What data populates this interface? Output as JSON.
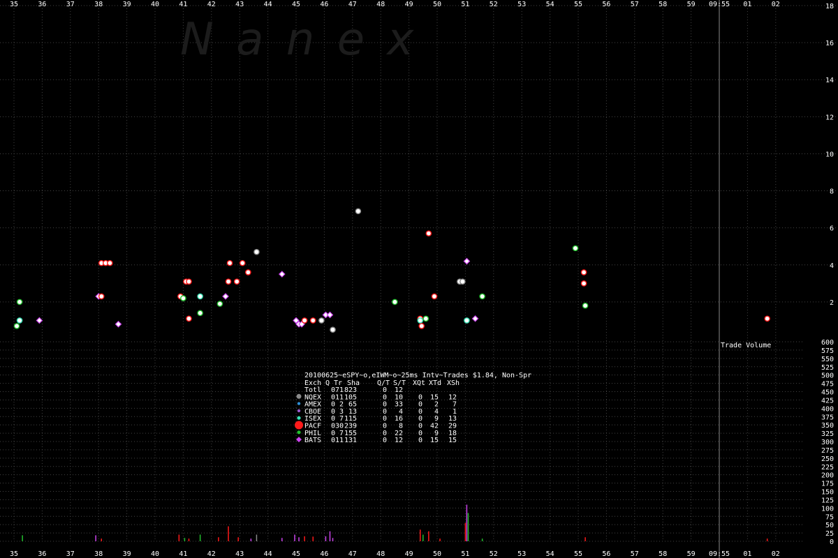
{
  "watermark": "N  a  n  e  x",
  "chart_data": {
    "type": "scatter",
    "x_ticks": [
      "35",
      "36",
      "37",
      "38",
      "39",
      "40",
      "41",
      "42",
      "43",
      "44",
      "45",
      "46",
      "47",
      "48",
      "49",
      "50",
      "51",
      "52",
      "53",
      "54",
      "55",
      "56",
      "57",
      "58",
      "59",
      "09:55",
      "01",
      "02"
    ],
    "x_ticks_bottom": [
      "35",
      "36",
      "37",
      "38",
      "39",
      "40",
      "41",
      "42",
      "43",
      "44",
      "45",
      "46",
      "47",
      "48",
      "49",
      "50",
      "51",
      "52",
      "53",
      "54",
      "55",
      "56",
      "57",
      "58",
      "59",
      "09:55",
      "01",
      "02"
    ],
    "grid": true,
    "price_panel": {
      "ylim": [
        0,
        18
      ],
      "y_ticks": [
        2,
        4,
        6,
        8,
        10,
        12,
        14,
        16,
        18
      ],
      "points": [
        {
          "x": 35.1,
          "y": 0.7,
          "ex": "PHIL"
        },
        {
          "x": 35.2,
          "y": 1.0,
          "ex": "ISEX"
        },
        {
          "x": 35.2,
          "y": 2.0,
          "ex": "PHIL"
        },
        {
          "x": 35.9,
          "y": 1.0,
          "ex": "BATS"
        },
        {
          "x": 38.0,
          "y": 2.3,
          "ex": "BATS"
        },
        {
          "x": 38.1,
          "y": 2.3,
          "ex": "PACF"
        },
        {
          "x": 38.1,
          "y": 4.1,
          "ex": "PACF"
        },
        {
          "x": 38.25,
          "y": 4.1,
          "ex": "PACF"
        },
        {
          "x": 38.4,
          "y": 4.1,
          "ex": "PACF"
        },
        {
          "x": 38.7,
          "y": 0.8,
          "ex": "BATS"
        },
        {
          "x": 40.9,
          "y": 2.3,
          "ex": "PACF"
        },
        {
          "x": 41.0,
          "y": 2.2,
          "ex": "PHIL"
        },
        {
          "x": 41.1,
          "y": 3.1,
          "ex": "PACF"
        },
        {
          "x": 41.2,
          "y": 3.1,
          "ex": "PACF"
        },
        {
          "x": 41.2,
          "y": 1.1,
          "ex": "PACF"
        },
        {
          "x": 41.6,
          "y": 2.3,
          "ex": "ISEX"
        },
        {
          "x": 41.6,
          "y": 1.4,
          "ex": "PHIL"
        },
        {
          "x": 42.3,
          "y": 1.9,
          "ex": "PHIL"
        },
        {
          "x": 42.5,
          "y": 2.3,
          "ex": "BATS"
        },
        {
          "x": 42.6,
          "y": 3.1,
          "ex": "PACF"
        },
        {
          "x": 42.65,
          "y": 4.1,
          "ex": "PACF"
        },
        {
          "x": 42.9,
          "y": 3.1,
          "ex": "PACF"
        },
        {
          "x": 43.1,
          "y": 4.1,
          "ex": "PACF"
        },
        {
          "x": 43.3,
          "y": 3.6,
          "ex": "PACF"
        },
        {
          "x": 43.6,
          "y": 4.7,
          "ex": "NQEX"
        },
        {
          "x": 44.5,
          "y": 3.5,
          "ex": "BATS"
        },
        {
          "x": 45.0,
          "y": 1.0,
          "ex": "BATS"
        },
        {
          "x": 45.1,
          "y": 0.8,
          "ex": "BATS"
        },
        {
          "x": 45.2,
          "y": 0.8,
          "ex": "BATS"
        },
        {
          "x": 45.3,
          "y": 1.0,
          "ex": "PACF"
        },
        {
          "x": 45.6,
          "y": 1.0,
          "ex": "PACF"
        },
        {
          "x": 45.9,
          "y": 1.0,
          "ex": "NQEX"
        },
        {
          "x": 46.05,
          "y": 1.3,
          "ex": "BATS"
        },
        {
          "x": 46.2,
          "y": 1.3,
          "ex": "BATS"
        },
        {
          "x": 46.3,
          "y": 0.5,
          "ex": "NQEX"
        },
        {
          "x": 47.2,
          "y": 6.9,
          "ex": "NQEX"
        },
        {
          "x": 48.5,
          "y": 2.0,
          "ex": "PHIL"
        },
        {
          "x": 49.4,
          "y": 1.1,
          "ex": "PACF"
        },
        {
          "x": 49.4,
          "y": 1.0,
          "ex": "ISEX"
        },
        {
          "x": 49.45,
          "y": 0.7,
          "ex": "PACF"
        },
        {
          "x": 49.6,
          "y": 1.1,
          "ex": "PHIL"
        },
        {
          "x": 49.7,
          "y": 5.7,
          "ex": "PACF"
        },
        {
          "x": 49.9,
          "y": 2.3,
          "ex": "PACF"
        },
        {
          "x": 50.8,
          "y": 3.1,
          "ex": "NQEX"
        },
        {
          "x": 50.9,
          "y": 3.1,
          "ex": "NQEX"
        },
        {
          "x": 51.05,
          "y": 4.2,
          "ex": "BATS"
        },
        {
          "x": 51.05,
          "y": 1.0,
          "ex": "ISEX"
        },
        {
          "x": 51.35,
          "y": 1.1,
          "ex": "BATS"
        },
        {
          "x": 51.6,
          "y": 2.3,
          "ex": "PHIL"
        },
        {
          "x": 54.9,
          "y": 4.9,
          "ex": "PHIL"
        },
        {
          "x": 55.2,
          "y": 3.6,
          "ex": "PACF"
        },
        {
          "x": 55.2,
          "y": 3.0,
          "ex": "PACF"
        },
        {
          "x": 55.25,
          "y": 1.8,
          "ex": "PHIL"
        },
        {
          "x": 61.7,
          "y": 1.1,
          "ex": "PACF"
        }
      ]
    },
    "volume_panel": {
      "label": "Trade Volume",
      "ylim": [
        0,
        600
      ],
      "y_ticks": [
        0,
        25,
        50,
        75,
        100,
        125,
        150,
        175,
        200,
        225,
        250,
        275,
        300,
        325,
        350,
        375,
        400,
        425,
        450,
        475,
        500,
        525,
        550,
        575,
        600
      ],
      "bars": [
        {
          "x": 35.3,
          "v": 18,
          "ex": "PHIL"
        },
        {
          "x": 37.9,
          "v": 18,
          "ex": "BATS"
        },
        {
          "x": 38.1,
          "v": 8,
          "ex": "PACF"
        },
        {
          "x": 40.85,
          "v": 20,
          "ex": "PACF"
        },
        {
          "x": 41.05,
          "v": 10,
          "ex": "PHIL"
        },
        {
          "x": 41.2,
          "v": 8,
          "ex": "PACF"
        },
        {
          "x": 41.6,
          "v": 20,
          "ex": "PHIL"
        },
        {
          "x": 42.25,
          "v": 12,
          "ex": "PACF"
        },
        {
          "x": 42.6,
          "v": 45,
          "ex": "PACF"
        },
        {
          "x": 42.95,
          "v": 12,
          "ex": "PACF"
        },
        {
          "x": 43.4,
          "v": 8,
          "ex": "BATS"
        },
        {
          "x": 43.6,
          "v": 20,
          "ex": "NQEX"
        },
        {
          "x": 44.5,
          "v": 10,
          "ex": "BATS"
        },
        {
          "x": 44.95,
          "v": 20,
          "ex": "BATS"
        },
        {
          "x": 45.1,
          "v": 12,
          "ex": "BATS"
        },
        {
          "x": 45.3,
          "v": 15,
          "ex": "PACF"
        },
        {
          "x": 45.6,
          "v": 14,
          "ex": "PACF"
        },
        {
          "x": 46.05,
          "v": 15,
          "ex": "BATS"
        },
        {
          "x": 46.2,
          "v": 30,
          "ex": "BATS"
        },
        {
          "x": 46.3,
          "v": 10,
          "ex": "BATS"
        },
        {
          "x": 49.4,
          "v": 35,
          "ex": "PACF"
        },
        {
          "x": 49.5,
          "v": 20,
          "ex": "PHIL"
        },
        {
          "x": 49.7,
          "v": 30,
          "ex": "PACF"
        },
        {
          "x": 50.1,
          "v": 8,
          "ex": "PACF"
        },
        {
          "x": 51.05,
          "v": 110,
          "ex": "BATS"
        },
        {
          "x": 51.1,
          "v": 85,
          "ex": "PHIL"
        },
        {
          "x": 51.0,
          "v": 55,
          "ex": "PACF"
        },
        {
          "x": 51.6,
          "v": 8,
          "ex": "PHIL"
        },
        {
          "x": 55.25,
          "v": 12,
          "ex": "PACF"
        },
        {
          "x": 61.7,
          "v": 8,
          "ex": "PACF"
        }
      ]
    },
    "legend": {
      "placement": "center",
      "title": "20100625~eSPY~o,eIWM~o~25ms Intv~Trades $1.84, Non-Spr",
      "header": [
        "Exch",
        "Q",
        "Tr",
        "Sha",
        "Q/T",
        "S/T",
        "XQt",
        "XTd",
        "XSh"
      ],
      "rows": [
        {
          "name": "Totl",
          "values": [
            "0",
            "71",
            "823",
            "0",
            "12",
            "",
            "",
            ""
          ]
        },
        {
          "name": "NQEX",
          "values": [
            "0",
            "11",
            "105",
            "0",
            "10",
            "0",
            "15",
            "12"
          ]
        },
        {
          "name": "AMEX",
          "values": [
            "0",
            "2",
            "65",
            "0",
            "33",
            "0",
            "2",
            "7"
          ]
        },
        {
          "name": "CBOE",
          "values": [
            "0",
            "3",
            "13",
            "0",
            "4",
            "0",
            "4",
            "1"
          ]
        },
        {
          "name": "ISEX",
          "values": [
            "0",
            "7",
            "115",
            "0",
            "16",
            "0",
            "9",
            "13"
          ]
        },
        {
          "name": "PACF",
          "values": [
            "0",
            "30",
            "239",
            "0",
            "8",
            "0",
            "42",
            "29"
          ]
        },
        {
          "name": "PHIL",
          "values": [
            "0",
            "7",
            "155",
            "0",
            "22",
            "0",
            "9",
            "18"
          ]
        },
        {
          "name": "BATS",
          "values": [
            "0",
            "11",
            "131",
            "0",
            "12",
            "0",
            "15",
            "15"
          ]
        }
      ]
    },
    "colors": {
      "NQEX": "#8a8a8a",
      "AMEX": "#2e8fd6",
      "CBOE": "#9b59d0",
      "ISEX": "#36e0b4",
      "PACF": "#ff1a1a",
      "PHIL": "#22c02e",
      "BATS": "#cc44ee",
      "grid": "#444444",
      "text": "#ffffff",
      "cursor": "#8a8a8a"
    },
    "cursor_x_label": "09:55"
  }
}
